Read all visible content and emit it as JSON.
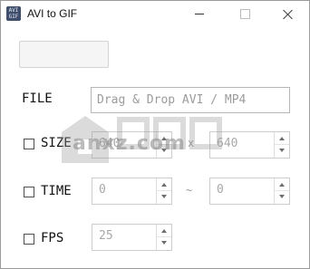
{
  "window": {
    "title": "AVI to GIF",
    "icon_text": "AVI GIF"
  },
  "file": {
    "label": "FILE",
    "placeholder": "Drag & Drop AVI / MP4"
  },
  "size": {
    "label": "SIZE",
    "width": "640",
    "separator": "x",
    "height": "640"
  },
  "time": {
    "label": "TIME",
    "start": "0",
    "separator": "~",
    "end": "0"
  },
  "fps": {
    "label": "FPS",
    "value": "25"
  },
  "watermark": {
    "text": "anxz.com"
  }
}
